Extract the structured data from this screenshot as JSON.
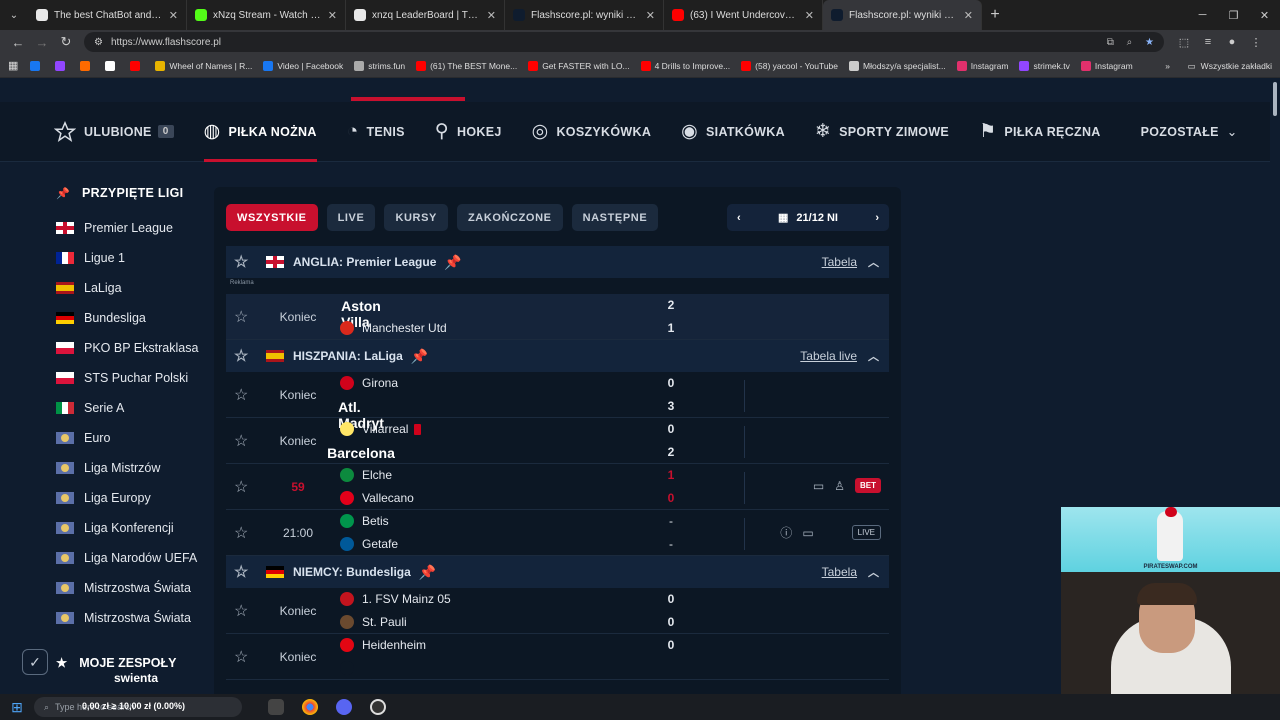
{
  "browser": {
    "tabs": [
      {
        "title": "The best ChatBot and Widg",
        "color": "#e8e8e8"
      },
      {
        "title": "xNzq Stream - Watch Live on K",
        "color": "#53fc18"
      },
      {
        "title": "xnzq LeaderBoard | The best Ch",
        "color": "#e8e8e8"
      },
      {
        "title": "Flashscore.pl: wyniki piłki nożne",
        "color": "#0f1c2e"
      },
      {
        "title": "(63) I Went Undercover as Sant",
        "color": "#ff0000"
      },
      {
        "title": "Flashscore.pl: wyniki piłki nożne",
        "color": "#0f1c2e"
      }
    ],
    "url": "https://www.flashscore.pl",
    "bookmarks": [
      {
        "label": "",
        "color": "#1877f2"
      },
      {
        "label": "",
        "color": "#9146ff"
      },
      {
        "label": "",
        "color": "#ff6a00"
      },
      {
        "label": "",
        "color": "#ffffff"
      },
      {
        "label": "",
        "color": "#ff0000"
      },
      {
        "label": "Wheel of Names | R...",
        "color": "#e8b400"
      },
      {
        "label": "Video | Facebook",
        "color": "#1877f2"
      },
      {
        "label": "strims.fun",
        "color": "#aaaaaa"
      },
      {
        "label": "(61) The BEST Mone...",
        "color": "#ff0000"
      },
      {
        "label": "Get FASTER with LO...",
        "color": "#ff0000"
      },
      {
        "label": "4 Drills to Improve...",
        "color": "#ff0000"
      },
      {
        "label": "(58) yacool - YouTube",
        "color": "#ff0000"
      },
      {
        "label": "Młodszy/a specjalist...",
        "color": "#cccccc"
      },
      {
        "label": "Instagram",
        "color": "#e1306c"
      },
      {
        "label": "strimek.tv",
        "color": "#9146ff"
      },
      {
        "label": "Instagram",
        "color": "#e1306c"
      }
    ],
    "all_bookmarks": "Wszystkie zakładki"
  },
  "nav": {
    "favorites": "ULUBIONE",
    "favorites_count": "0",
    "sports": [
      "PIŁKA NOŻNA",
      "TENIS",
      "HOKEJ",
      "KOSZYKÓWKA",
      "SIATKÓWKA",
      "SPORTY ZIMOWE",
      "PIŁKA RĘCZNA"
    ],
    "more": "POZOSTAŁE"
  },
  "sidebar": {
    "title": "PRZYPIĘTE LIGI",
    "leagues": [
      {
        "name": "Premier League",
        "flag": "eng"
      },
      {
        "name": "Ligue 1",
        "flag": "fra"
      },
      {
        "name": "LaLiga",
        "flag": "esp"
      },
      {
        "name": "Bundesliga",
        "flag": "ger"
      },
      {
        "name": "PKO BP Ekstraklasa",
        "flag": "pol"
      },
      {
        "name": "STS Puchar Polski",
        "flag": "pol"
      },
      {
        "name": "Serie A",
        "flag": "ita"
      },
      {
        "name": "Euro",
        "flag": "world"
      },
      {
        "name": "Liga Mistrzów",
        "flag": "world"
      },
      {
        "name": "Liga Europy",
        "flag": "world"
      },
      {
        "name": "Liga Konferencji",
        "flag": "world"
      },
      {
        "name": "Liga Narodów UEFA",
        "flag": "world"
      },
      {
        "name": "Mistrzostwa Świata",
        "flag": "world"
      },
      {
        "name": "Mistrzostwa Świata",
        "flag": "world"
      }
    ],
    "my_teams": "MOJE ZESPOŁY",
    "overlay_text": "swienta"
  },
  "filters": [
    "WSZYSTKIE",
    "LIVE",
    "KURSY",
    "ZAKOŃCZONE",
    "NASTĘPNE"
  ],
  "date": "21/12 NI",
  "ad_label": "Reklama",
  "leagues": [
    {
      "name": "ANGLIA: Premier League",
      "flag": "eng",
      "link": "Tabela",
      "matches": [
        {
          "status": "Koniec",
          "home": "Aston Villa",
          "away": "Manchester Utd",
          "hs": "2",
          "as": "1",
          "hwin": true,
          "awin": false,
          "hcrest": "#95bfe5",
          "acrest": "#da291c"
        }
      ]
    },
    {
      "name": "HISZPANIA: LaLiga",
      "flag": "esp",
      "link": "Tabela live",
      "matches": [
        {
          "status": "Koniec",
          "home": "Girona",
          "away": "Atl. Madryt",
          "hs": "0",
          "as": "3",
          "hwin": false,
          "awin": true,
          "hcrest": "#d0021b",
          "acrest": "#cb3524"
        },
        {
          "status": "Koniec",
          "home": "Villarreal",
          "away": "Barcelona",
          "hs": "0",
          "as": "2",
          "hwin": false,
          "awin": true,
          "hcrest": "#ffe667",
          "acrest": "#a50044"
        },
        {
          "status": "59",
          "home": "Elche",
          "away": "Vallecano",
          "hs": "1",
          "as": "0",
          "hwin": false,
          "awin": false,
          "hcrest": "#0c8a3e",
          "acrest": "#e2001a"
        },
        {
          "status": "21:00",
          "home": "Betis",
          "away": "Getafe",
          "hs": "-",
          "as": "-",
          "hwin": false,
          "awin": false,
          "hcrest": "#00954c",
          "acrest": "#005999"
        }
      ]
    },
    {
      "name": "NIEMCY: Bundesliga",
      "flag": "ger",
      "link": "Tabela",
      "matches": [
        {
          "status": "Koniec",
          "home": "1. FSV Mainz 05",
          "away": "St. Pauli",
          "hs": "0",
          "as": "0",
          "hwin": false,
          "awin": false,
          "hcrest": "#c3141e",
          "acrest": "#6b4a2f"
        },
        {
          "status": "Koniec",
          "home": "Heidenheim",
          "away": "",
          "hs": "0",
          "as": "",
          "hwin": false,
          "awin": false,
          "hcrest": "#e30613",
          "acrest": "#0c1724"
        }
      ]
    }
  ],
  "live_icons": {
    "bet": "BET",
    "live": "LIVE"
  },
  "cam": {
    "banner_text": "PIRATESWAP.COM"
  },
  "taskbar": {
    "search_placeholder": "Type here to search",
    "ticker": "0,00 zł ≥ 10,00 zł (0.00%)"
  }
}
